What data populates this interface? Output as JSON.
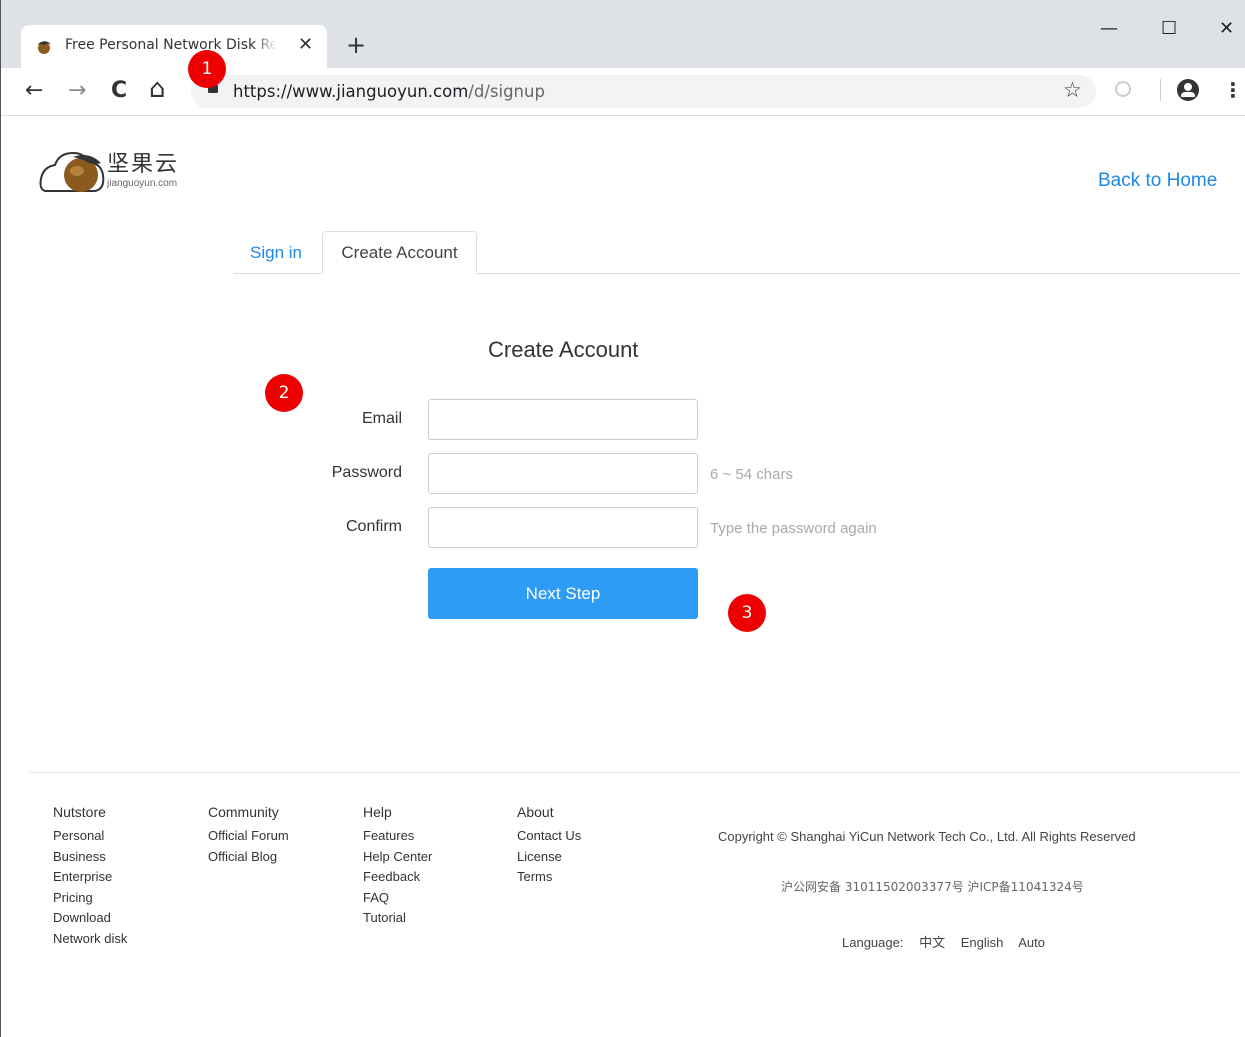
{
  "browser": {
    "tab_title": "Free Personal Network Disk Regis",
    "close_glyph": "✕",
    "new_tab_glyph": "+",
    "url_host": "https://www.jianguoyun.com",
    "url_path": "/d/signup",
    "nav": {
      "back_glyph": "←",
      "forward_glyph": "→",
      "reload_glyph": "C",
      "home_glyph": "⌂"
    },
    "star_glyph": "☆",
    "menu_glyph": "⋮",
    "window": {
      "minimize": "—",
      "maximize": "☐",
      "close": "✕"
    }
  },
  "header": {
    "logo_cn": "坚果云",
    "logo_sub": "jianguoyun.com",
    "back_home": "Back to Home"
  },
  "tabs": {
    "signin": "Sign in",
    "create": "Create Account"
  },
  "form": {
    "title": "Create Account",
    "email_label": "Email",
    "password_label": "Password",
    "password_hint": "6 ~ 54 chars",
    "confirm_label": "Confirm",
    "confirm_hint": "Type the password again",
    "email_value": "",
    "password_value": "",
    "confirm_value": "",
    "next_button": "Next Step"
  },
  "markers": [
    "1",
    "2",
    "3"
  ],
  "footer": {
    "columns": [
      {
        "heading": "Nutstore",
        "links": [
          "Personal",
          "Business",
          "Enterprise",
          "Pricing",
          "Download",
          "Network disk"
        ]
      },
      {
        "heading": "Community",
        "links": [
          "Official Forum",
          "Official Blog"
        ]
      },
      {
        "heading": "Help",
        "links": [
          "Features",
          "Help Center",
          "Feedback",
          "FAQ",
          "Tutorial"
        ]
      },
      {
        "heading": "About",
        "links": [
          "Contact Us",
          "License",
          "Terms"
        ]
      }
    ],
    "copyright": "Copyright © Shanghai YiCun Network Tech Co., Ltd.  All Rights Reserved",
    "icp": "沪公网安备 31011502003377号 沪ICP备11041324号",
    "language_label": "Language:",
    "languages": [
      "中文",
      "English",
      "Auto"
    ]
  },
  "colors": {
    "accent": "#2e9bf6",
    "link": "#1e88e5",
    "marker": "#ee0000"
  }
}
